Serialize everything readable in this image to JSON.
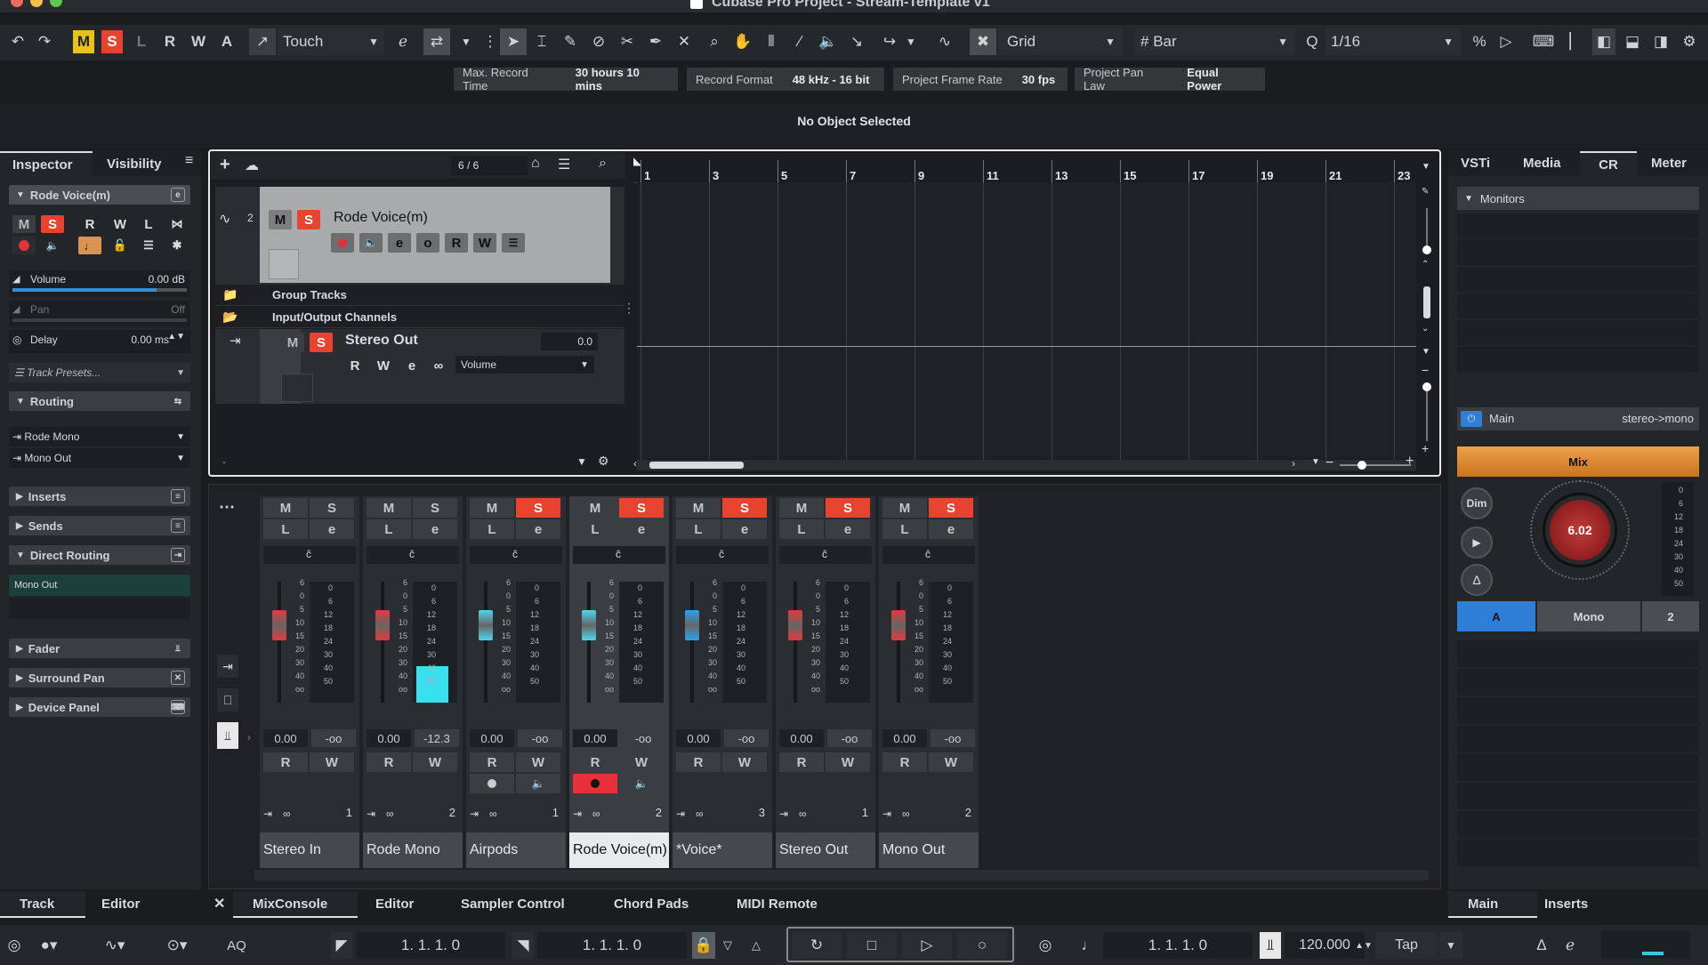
{
  "window": {
    "title": "Cubase Pro Project - Stream-Template v1"
  },
  "toolbar": {
    "m": "M",
    "s": "S",
    "l": "L",
    "r": "R",
    "w": "W",
    "a": "A",
    "automation_mode": "Touch",
    "snap_type": "Grid",
    "grid_type": "Bar",
    "quantize": "1/16"
  },
  "infoline": [
    {
      "label": "Max. Record Time",
      "value": "30 hours 10 mins"
    },
    {
      "label": "Record Format",
      "value": "48 kHz - 16 bit"
    },
    {
      "label": "Project Frame Rate",
      "value": "30 fps"
    },
    {
      "label": "Project Pan Law",
      "value": "Equal Power"
    }
  ],
  "status": "No Object Selected",
  "inspector": {
    "tabs": [
      "Inspector",
      "Visibility"
    ],
    "track_name": "Rode Voice(m)",
    "volume_label": "Volume",
    "volume_value": "0.00 dB",
    "pan_label": "Pan",
    "pan_value": "Off",
    "delay_label": "Delay",
    "delay_value": "0.00 ms",
    "presets": "Track Presets...",
    "routing": "Routing",
    "routing_in": "Rode Mono",
    "routing_out": "Mono Out",
    "sections": [
      "Inserts",
      "Sends",
      "Direct Routing"
    ],
    "direct_routing_value": "Mono Out",
    "sections2": [
      "Fader",
      "Surround Pan",
      "Device Panel"
    ],
    "bottom_tabs": [
      "Track",
      "Editor"
    ]
  },
  "project": {
    "track_count": "6 / 6",
    "track_num": "2",
    "track_name": "Rode Voice(m)",
    "folder1": "Group Tracks",
    "folder2": "Input/Output Channels",
    "stereo_out": "Stereo Out",
    "stereo_out_value": "0.0",
    "automation_param": "Volume",
    "ruler": [
      "1",
      "3",
      "5",
      "7",
      "9",
      "11",
      "13",
      "15",
      "17",
      "19",
      "21",
      "23"
    ]
  },
  "mixer": {
    "strips": [
      {
        "name": "Stereo In",
        "num": "1",
        "vol": "0.00",
        "pan": "-oo",
        "solo": false,
        "color": "#e23a3a",
        "level": 0
      },
      {
        "name": "Rode Mono",
        "num": "2",
        "vol": "0.00",
        "pan": "-12.3",
        "solo": false,
        "color": "#e23a3a",
        "level": 0.3
      },
      {
        "name": "Airpods",
        "num": "1",
        "vol": "0.00",
        "pan": "-oo",
        "solo": true,
        "color": "#4fd6ee",
        "level": 0
      },
      {
        "name": "Rode Voice(m)",
        "num": "2",
        "vol": "0.00",
        "pan": "-oo",
        "solo": true,
        "color": "#4fd6ee",
        "level": 0
      },
      {
        "name": "*Voice*",
        "num": "3",
        "vol": "0.00",
        "pan": "-oo",
        "solo": true,
        "color": "#2aa2ee",
        "level": 0
      },
      {
        "name": "Stereo Out",
        "num": "1",
        "vol": "0.00",
        "pan": "-oo",
        "solo": true,
        "color": "#e23a3a",
        "level": 0
      },
      {
        "name": "Mono Out",
        "num": "2",
        "vol": "0.00",
        "pan": "-oo",
        "solo": true,
        "color": "#e23a3a",
        "level": 0
      }
    ],
    "scale_left": [
      "6",
      "0",
      "5",
      "10",
      "15",
      "20",
      "30",
      "40",
      "oo"
    ],
    "scale_right": [
      "0",
      "6",
      "12",
      "18",
      "24",
      "30",
      "40",
      "50"
    ],
    "tabs": [
      "MixConsole",
      "Editor",
      "Sampler Control",
      "Chord Pads",
      "MIDI Remote"
    ]
  },
  "right_zone": {
    "tabs": [
      "VSTi",
      "Media",
      "CR",
      "Meter"
    ],
    "monitors": "Monitors",
    "main": "Main",
    "main_route": "stereo->mono",
    "mix": "Mix",
    "dim": "Dim",
    "knob_value": "6.02",
    "a_btn": "A",
    "mono_btn": "Mono",
    "two_btn": "2",
    "bottom_tabs": [
      "Main",
      "Inserts"
    ],
    "meter_scale": [
      "0",
      "6",
      "12",
      "18",
      "24",
      "30",
      "40",
      "50"
    ]
  },
  "transport": {
    "left_locator": "1. 1. 1.    0",
    "right_locator": "1. 1. 1.    0",
    "position": "1. 1. 1.    0",
    "tempo": "120.000",
    "tap": "Tap",
    "aq": "AQ"
  },
  "colors": {
    "accent_red": "#e8432e",
    "accent_yellow": "#e8c41b",
    "accent_blue": "#2f7fd8",
    "mix_orange": "#e08a28"
  }
}
